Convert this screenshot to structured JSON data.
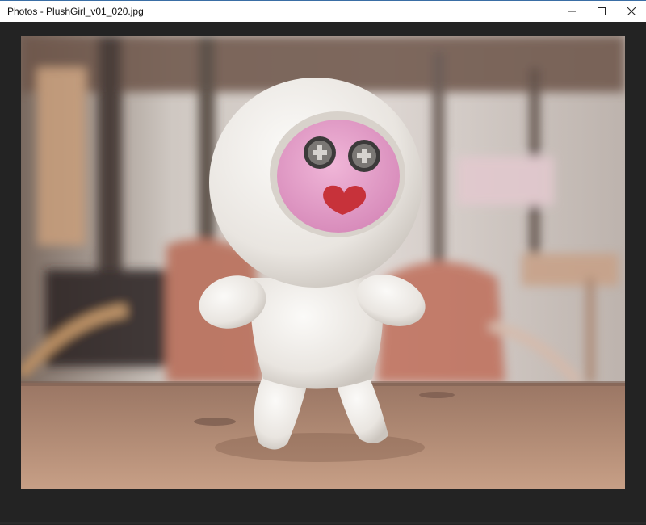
{
  "window": {
    "title": "Photos - PlushGirl_v01_020.jpg",
    "controls": {
      "minimize_icon": "minimize-icon",
      "maximize_icon": "maximize-icon",
      "close_icon": "close-icon"
    }
  },
  "photo": {
    "subject": "plush-doll-icon"
  },
  "colors": {
    "titlebar_bg": "#ffffff",
    "viewer_bg": "#232323",
    "accent_border": "#3a6ea5"
  }
}
